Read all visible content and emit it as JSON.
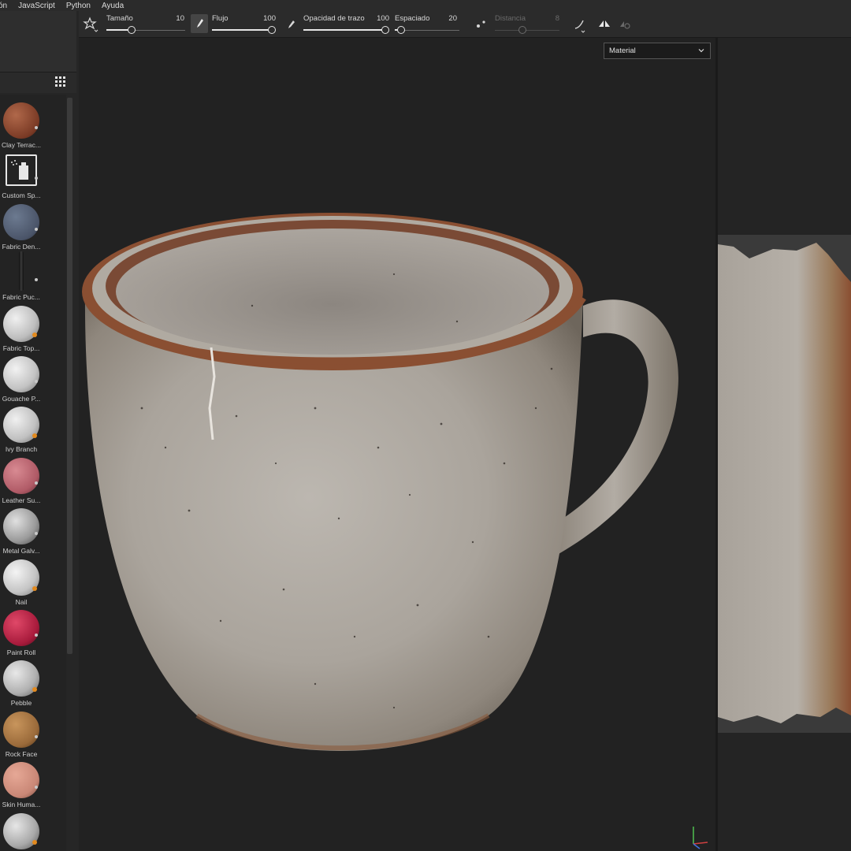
{
  "menu": [
    "ón",
    "JavaScript",
    "Python",
    "Ayuda"
  ],
  "toolbar": {
    "size_label": "Tamaño",
    "size_value": "10",
    "flow_label": "Flujo",
    "flow_value": "100",
    "opacity_label": "Opacidad de trazo",
    "opacity_value": "100",
    "spacing_label": "Espaciado",
    "spacing_value": "20",
    "distance_label": "Distancia",
    "distance_value": "8"
  },
  "viewport": {
    "channel_select": "Material"
  },
  "shelf": {
    "items": [
      {
        "label": "Clay Terrac...",
        "icon": "clay-terracotta-material",
        "badge": "alt"
      },
      {
        "label": "Custom Sp...",
        "icon": "custom-spray-tool",
        "badge": "alt"
      },
      {
        "label": "Fabric Den...",
        "icon": "fabric-denim-material",
        "badge": "alt"
      },
      {
        "label": "Fabric Puc...",
        "icon": "fabric-pucker-tool",
        "badge": "alt"
      },
      {
        "label": "Fabric Top...",
        "icon": "fabric-top-material",
        "badge": "orange"
      },
      {
        "label": "Gouache P...",
        "icon": "gouache-paint-material",
        "badge": "alt"
      },
      {
        "label": "Ivy Branch",
        "icon": "ivy-branch-material",
        "badge": "orange"
      },
      {
        "label": "Leather Su...",
        "icon": "leather-suede-material",
        "badge": "alt"
      },
      {
        "label": "Metal Galv...",
        "icon": "metal-galvanized-material",
        "badge": "alt"
      },
      {
        "label": "Nail",
        "icon": "nail-material",
        "badge": "orange"
      },
      {
        "label": "Paint Roll",
        "icon": "paint-roll-material",
        "badge": "alt"
      },
      {
        "label": "Pebble",
        "icon": "pebble-material",
        "badge": "orange"
      },
      {
        "label": "Rock Face",
        "icon": "rock-face-material",
        "badge": "alt"
      },
      {
        "label": "Skin Huma...",
        "icon": "skin-human-material",
        "badge": "alt"
      },
      {
        "label": "",
        "icon": "stitch-material",
        "badge": "orange"
      }
    ]
  },
  "colors": {
    "clay": "#8a4a33",
    "denim": "#4f5a6e",
    "leather": "#b5606a",
    "paint": "#a81b3c",
    "rock": "#9a6a3a",
    "skin": "#c98776",
    "metal": "#b8b8b8",
    "badge": "#e28a1f"
  }
}
